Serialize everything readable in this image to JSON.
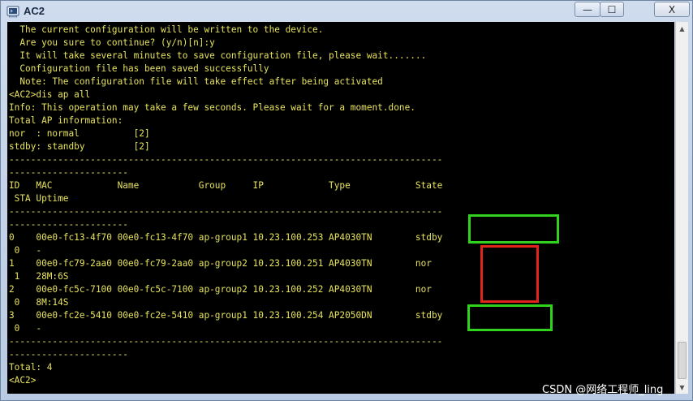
{
  "window": {
    "title": "AC2",
    "minimize_glyph": "—",
    "maximize_glyph": "☐",
    "close_glyph": "X",
    "app_icon": "terminal-app-icon"
  },
  "terminal": {
    "lines": [
      "  The current configuration will be written to the device.",
      "  Are you sure to continue? (y/n)[n]:y",
      "  It will take several minutes to save configuration file, please wait.......",
      "  Configuration file has been saved successfully",
      "  Note: The configuration file will take effect after being activated",
      "<AC2>dis ap all",
      "Info: This operation may take a few seconds. Please wait for a moment.done.",
      "Total AP information:",
      "nor  : normal          [2]",
      "stdby: standby         [2]",
      "--------------------------------------------------------------------------------",
      "----------------------",
      "ID   MAC            Name           Group     IP            Type            State",
      " STA Uptime",
      "--------------------------------------------------------------------------------",
      "----------------------",
      "0    00e0-fc13-4f70 00e0-fc13-4f70 ap-group1 10.23.100.253 AP4030TN        stdby",
      " 0   -",
      "1    00e0-fc79-2aa0 00e0-fc79-2aa0 ap-group2 10.23.100.251 AP4030TN        nor",
      " 1   28M:6S",
      "2    00e0-fc5c-7100 00e0-fc5c-7100 ap-group2 10.23.100.252 AP4030TN        nor",
      " 0   8M:14S",
      "3    00e0-fc2e-5410 00e0-fc2e-5410 ap-group1 10.23.100.254 AP2050DN        stdby",
      " 0   -",
      "--------------------------------------------------------------------------------",
      "----------------------",
      "Total: 4",
      "<AC2>"
    ]
  },
  "colors": {
    "terminal_bg": "#000000",
    "terminal_fg": "#e7e35a",
    "highlight_green": "#2fd21c",
    "highlight_red": "#e0261c"
  },
  "watermark": "CSDN @网络工程师_ling"
}
